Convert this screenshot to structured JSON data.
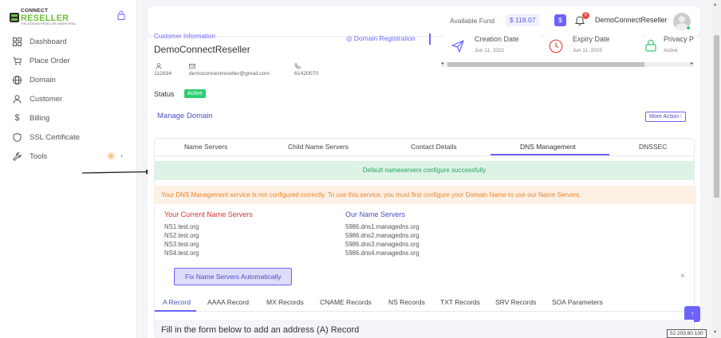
{
  "brand": {
    "top": "CONNECT",
    "main": "RESELLER",
    "sub": "THE DOMAIN RESELLER WEBPORTAL"
  },
  "sidebar": {
    "items": [
      {
        "label": "Dashboard",
        "icon": "grid-icon"
      },
      {
        "label": "Place Order",
        "icon": "cart-icon"
      },
      {
        "label": "Domain",
        "icon": "globe-icon"
      },
      {
        "label": "Customer",
        "icon": "user-icon"
      },
      {
        "label": "Billing",
        "icon": "dollar-icon"
      },
      {
        "label": "SSL Certificate",
        "icon": "shield-icon"
      },
      {
        "label": "Tools",
        "icon": "wrench-icon",
        "badge": "9",
        "chevron": "›"
      }
    ]
  },
  "header": {
    "fund_label": "Available Fund",
    "fund_value": "$ 118.07",
    "dollar": "$",
    "notif_count": "0",
    "user": "DemoConnectReseller"
  },
  "customer": {
    "section_title": "Customer Information",
    "domain_registration": "Domain Registration",
    "name": "DemoConnectReseller",
    "id": "112834",
    "email": "democonnectreseller@gmail.com",
    "phone": "61420070",
    "status_label": "Status",
    "status_value": "Active"
  },
  "stats": {
    "creation": {
      "title": "Creation Date",
      "value": "Jun 11, 2022"
    },
    "expiry": {
      "title": "Expiry Date",
      "value": "Jun 11, 2025"
    },
    "privacy": {
      "title": "Privacy P",
      "value": "Active"
    }
  },
  "manage": {
    "title": "Manage Domain",
    "more_action": "More Action ⁝"
  },
  "tabs": [
    "Name Servers",
    "Child Name Servers",
    "Contact Details",
    "DNS Management",
    "DNSSEC"
  ],
  "alerts": {
    "success": "Default nameservers configure successfully",
    "warning": "Your DNS Management service is not configured correctly. To use this service, you must first configure your Domain Name to use our Name Servers."
  },
  "current_ns": {
    "title": "Your Current Name Servers",
    "items": [
      "NS1.test.org",
      "NS2.test.org",
      "NS3.test.org",
      "NS4.test.org"
    ]
  },
  "our_ns": {
    "title": "Our Name Servers",
    "items": [
      "5986.dns1.managedns.org",
      "5986.dns2.managedns.org",
      "5986.dns3.managedns.org",
      "5986.dns4.managedns.org"
    ]
  },
  "fix_button": "Fix Name Servers Automatically",
  "close": "×",
  "record_tabs": [
    "A Record",
    "AAAA Record",
    "MX Records",
    "CNAME Records",
    "NS Records",
    "TXT Records",
    "SRV Records",
    "SOA Parameters"
  ],
  "form_title": "Fill in the form below to add an address (A) Record",
  "ip_tip": "52.203.60.100",
  "scroll_top": "↑",
  "colors": {
    "accent": "#6c63ff",
    "success": "#2ecc71",
    "warning": "#e8842b",
    "danger": "#e74c3c",
    "brand_green": "#6fbf3a"
  }
}
